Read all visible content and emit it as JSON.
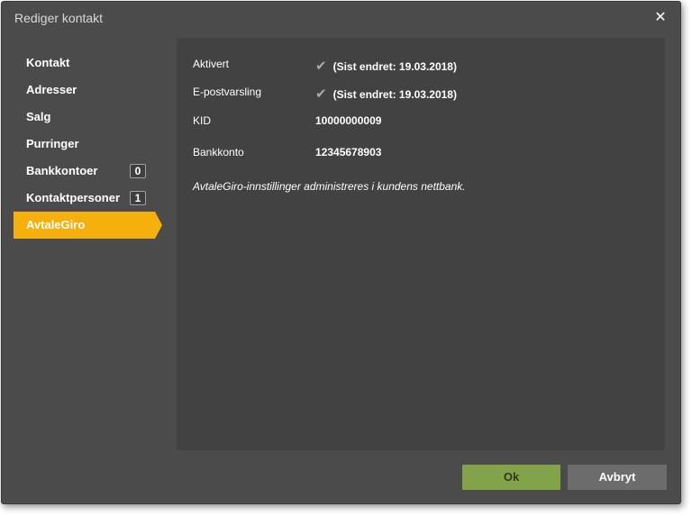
{
  "dialog": {
    "title": "Rediger kontakt",
    "close_symbol": "✕"
  },
  "nav": {
    "items": [
      {
        "label": "Kontakt"
      },
      {
        "label": "Adresser"
      },
      {
        "label": "Salg"
      },
      {
        "label": "Purringer"
      },
      {
        "label": "Bankkontoer",
        "badge": "0"
      },
      {
        "label": "Kontaktpersoner",
        "badge": "1"
      },
      {
        "label": "AvtaleGiro",
        "active": true
      }
    ]
  },
  "avtalegiro": {
    "aktivert_label": "Aktivert",
    "aktivert_value": "(Sist endret: 19.03.2018)",
    "epost_label": "E-postvarsling",
    "epost_value": "(Sist endret: 19.03.2018)",
    "kid_label": "KID",
    "kid_value": "10000000009",
    "bankkonto_label": "Bankkonto",
    "bankkonto_value": "12345678903",
    "note": "AvtaleGiro-innstillinger administreres i kundens nettbank."
  },
  "buttons": {
    "ok_label": "Ok",
    "cancel_label": "Avbryt"
  },
  "colors": {
    "accent": "#f5b00e",
    "ok_button": "#82a34a",
    "dialog_bg": "#4b4b4b",
    "panel_bg": "#424242"
  }
}
